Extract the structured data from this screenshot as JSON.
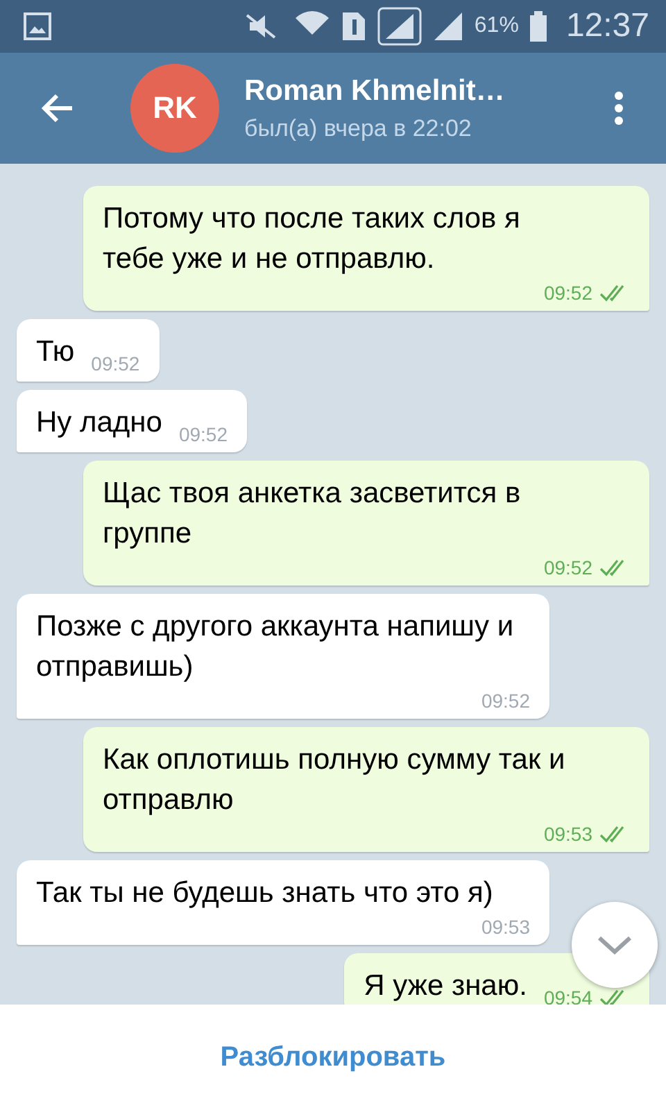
{
  "status_bar": {
    "battery": "61%",
    "time": "12:37"
  },
  "header": {
    "avatar_initials": "RK",
    "title": "Roman Khmelnit…",
    "subtitle": "был(а) вчера в 22:02"
  },
  "messages": [
    {
      "kind": "out",
      "text": "Потому что после таких слов я тебе уже и не отправлю.",
      "time": "09:52",
      "read": true
    },
    {
      "kind": "in",
      "text": "Тю",
      "time": "09:52"
    },
    {
      "kind": "in",
      "text": "Ну ладно",
      "time": "09:52"
    },
    {
      "kind": "out",
      "text": "Щас твоя анкетка засветится в группе",
      "time": "09:52",
      "read": true
    },
    {
      "kind": "in",
      "text": "Позже с другого аккаунта напишу и отправишь)",
      "time": "09:52"
    },
    {
      "kind": "out",
      "text": "Как оплотишь полную сумму так и отправлю",
      "time": "09:53",
      "read": true
    },
    {
      "kind": "in",
      "text": "Так ты не будешь знать что это я)",
      "time": "09:53"
    },
    {
      "kind": "out",
      "text": "Я уже знаю.",
      "time": "09:54",
      "read": true
    }
  ],
  "bottom_bar": {
    "button": "Разблокировать"
  }
}
